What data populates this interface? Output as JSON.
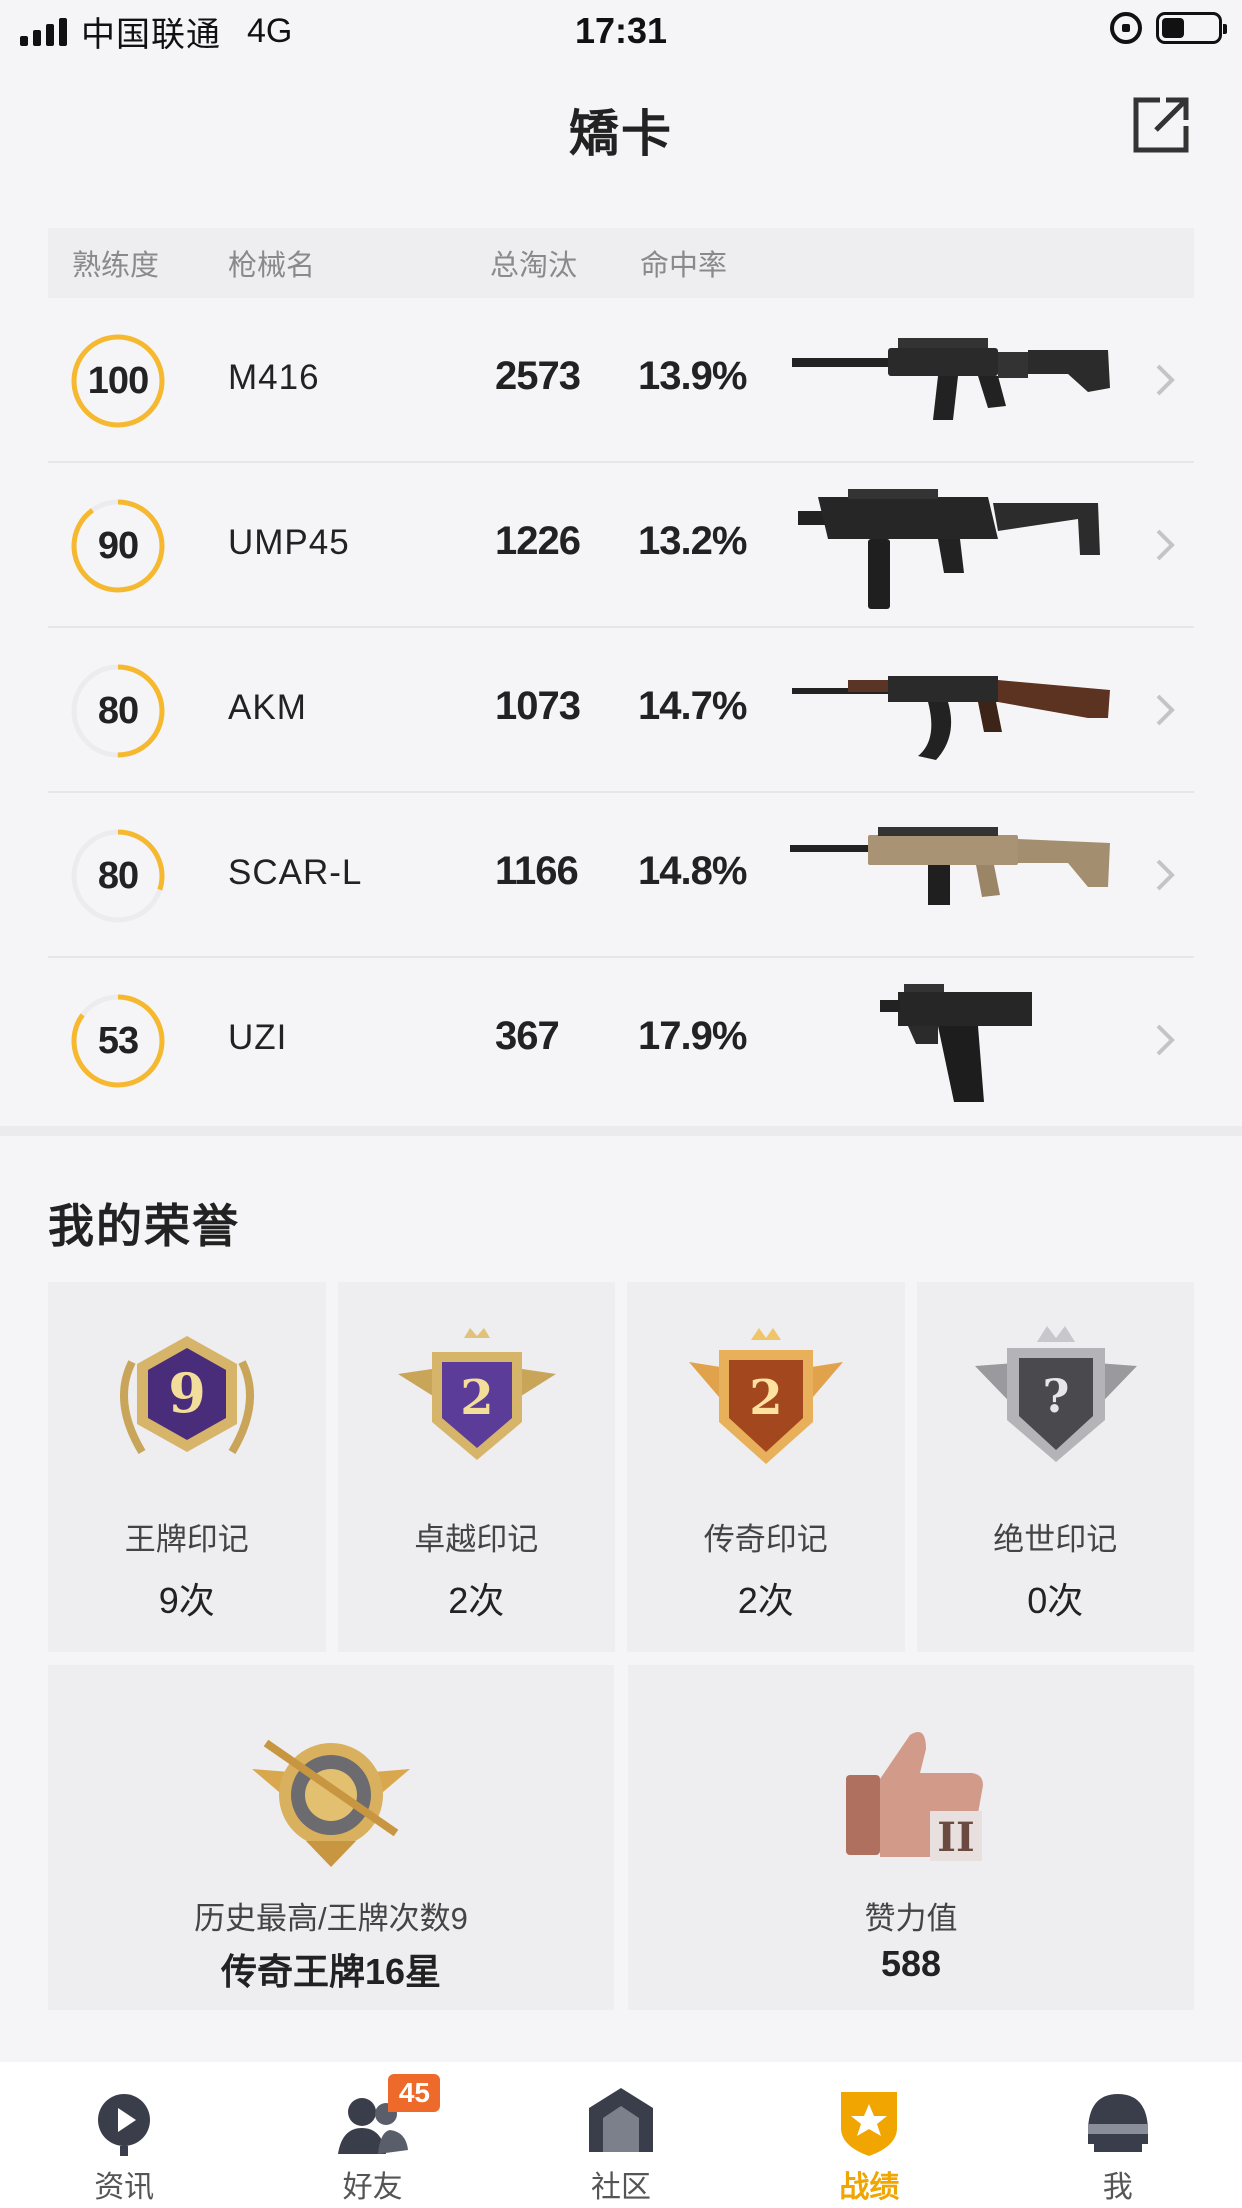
{
  "status_bar": {
    "carrier": "中国联通",
    "network": "4G",
    "time": "17:31"
  },
  "header": {
    "title": "矯卡"
  },
  "weapons": {
    "columns": [
      "熟练度",
      "枪械名",
      "总淘汰",
      "命中率"
    ],
    "rows": [
      {
        "proficiency": "100",
        "name": "M416",
        "kills": "2573",
        "hit_rate": "13.9%",
        "ring_fraction": 1.0
      },
      {
        "proficiency": "90",
        "name": "UMP45",
        "kills": "1226",
        "hit_rate": "13.2%",
        "ring_fraction": 0.9
      },
      {
        "proficiency": "80",
        "name": "AKM",
        "kills": "1073",
        "hit_rate": "14.7%",
        "ring_fraction": 0.5
      },
      {
        "proficiency": "80",
        "name": "SCAR-L",
        "kills": "1166",
        "hit_rate": "14.8%",
        "ring_fraction": 0.3
      },
      {
        "proficiency": "53",
        "name": "UZI",
        "kills": "367",
        "hit_rate": "17.9%",
        "ring_fraction": 0.85
      }
    ]
  },
  "honors": {
    "title": "我的荣誉",
    "cards": [
      {
        "name": "王牌印记",
        "count": "9次",
        "badge_text": "9",
        "icon": "ace-mark-badge-icon"
      },
      {
        "name": "卓越印记",
        "count": "2次",
        "badge_text": "2",
        "icon": "excellence-mark-badge-icon"
      },
      {
        "name": "传奇印记",
        "count": "2次",
        "badge_text": "2",
        "icon": "legend-mark-badge-icon"
      },
      {
        "name": "绝世印记",
        "count": "0次",
        "badge_text": "?",
        "icon": "peerless-mark-badge-icon"
      }
    ],
    "wide_cards": [
      {
        "name": "历史最高/王牌次数9",
        "value": "传奇王牌16星",
        "icon": "highest-tier-badge-icon"
      },
      {
        "name": "赞力值",
        "value": "588",
        "icon": "thumbs-up-badge-icon",
        "badge_text": "II"
      }
    ]
  },
  "tabbar": {
    "tabs": [
      {
        "label": "资讯",
        "icon": "news-icon"
      },
      {
        "label": "好友",
        "icon": "friends-icon",
        "badge": "45"
      },
      {
        "label": "社区",
        "icon": "community-icon"
      },
      {
        "label": "战绩",
        "icon": "record-icon",
        "active": true
      },
      {
        "label": "我",
        "icon": "profile-helmet-icon"
      }
    ]
  },
  "colors": {
    "accent": "#f5b82e",
    "active_tab": "#f0a500",
    "badge": "#ee6a2a"
  }
}
